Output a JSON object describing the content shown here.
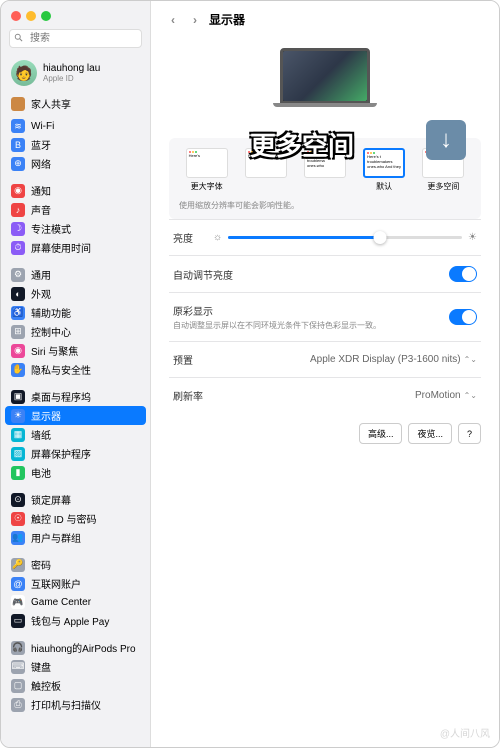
{
  "search_placeholder": "搜索",
  "user": {
    "name": "hiauhong lau",
    "sub": "Apple ID"
  },
  "family": "家人共享",
  "sidebar": [
    {
      "label": "Wi-Fi",
      "color": "#3b82f6",
      "glyph": "≋"
    },
    {
      "label": "蓝牙",
      "color": "#3b82f6",
      "glyph": "B"
    },
    {
      "label": "网络",
      "color": "#3b82f6",
      "glyph": "⊕"
    },
    {
      "sep": true
    },
    {
      "label": "通知",
      "color": "#ef4444",
      "glyph": "◉"
    },
    {
      "label": "声音",
      "color": "#ef4444",
      "glyph": "♪"
    },
    {
      "label": "专注模式",
      "color": "#8b5cf6",
      "glyph": "☽"
    },
    {
      "label": "屏幕使用时间",
      "color": "#8b5cf6",
      "glyph": "⏱"
    },
    {
      "sep": true
    },
    {
      "label": "通用",
      "color": "#9ca3af",
      "glyph": "⚙"
    },
    {
      "label": "外观",
      "color": "#111827",
      "glyph": "◐"
    },
    {
      "label": "辅助功能",
      "color": "#3b82f6",
      "glyph": "♿"
    },
    {
      "label": "控制中心",
      "color": "#9ca3af",
      "glyph": "⊞"
    },
    {
      "label": "Siri 与聚焦",
      "color": "#ec4899",
      "glyph": "◉"
    },
    {
      "label": "隐私与安全性",
      "color": "#3b82f6",
      "glyph": "✋"
    },
    {
      "sep": true
    },
    {
      "label": "桌面与程序坞",
      "color": "#111827",
      "glyph": "▣"
    },
    {
      "label": "显示器",
      "color": "#3b82f6",
      "glyph": "☀",
      "active": true
    },
    {
      "label": "墙纸",
      "color": "#06b6d4",
      "glyph": "▦"
    },
    {
      "label": "屏幕保护程序",
      "color": "#06b6d4",
      "glyph": "▨"
    },
    {
      "label": "电池",
      "color": "#22c55e",
      "glyph": "▮"
    },
    {
      "sep": true
    },
    {
      "label": "锁定屏幕",
      "color": "#111827",
      "glyph": "⊙"
    },
    {
      "label": "触控 ID 与密码",
      "color": "#ef4444",
      "glyph": "☉"
    },
    {
      "label": "用户与群组",
      "color": "#3b82f6",
      "glyph": "👥"
    },
    {
      "sep": true
    },
    {
      "label": "密码",
      "color": "#9ca3af",
      "glyph": "🔑"
    },
    {
      "label": "互联网账户",
      "color": "#3b82f6",
      "glyph": "@"
    },
    {
      "label": "Game Center",
      "color": "#fff",
      "glyph": "🎮"
    },
    {
      "label": "钱包与 Apple Pay",
      "color": "#111827",
      "glyph": "▭"
    },
    {
      "sep": true
    },
    {
      "label": "hiauhong的AirPods Pro",
      "color": "#9ca3af",
      "glyph": "🎧"
    },
    {
      "label": "键盘",
      "color": "#9ca3af",
      "glyph": "⌨"
    },
    {
      "label": "触控板",
      "color": "#9ca3af",
      "glyph": "▢"
    },
    {
      "label": "打印机与扫描仪",
      "color": "#9ca3af",
      "glyph": "⎙"
    }
  ],
  "title": "显示器",
  "overlay": "更多空间",
  "scale": {
    "opts": [
      {
        "label": "更大字体",
        "text": "Here's"
      },
      {
        "label": "",
        "text": "Here's to troublem"
      },
      {
        "label": "",
        "text": "Here's to t troublema ones.who"
      },
      {
        "label": "默认",
        "text": "Here's t troublemakers ones.who And they",
        "sel": true
      },
      {
        "label": "更多空间",
        "text": ""
      }
    ],
    "note": "使用缩放分辨率可能会影响性能。"
  },
  "rows": {
    "brightness": "亮度",
    "auto_brightness": "自动调节亮度",
    "true_tone": "原彩显示",
    "true_tone_sub": "自动调整显示屏以在不同环境光条件下保持色彩显示一致。",
    "preset": "预置",
    "preset_val": "Apple XDR Display (P3-1600 nits)",
    "refresh": "刷新率",
    "refresh_val": "ProMotion"
  },
  "buttons": {
    "advanced": "高级...",
    "night": "夜览...",
    "help": "?"
  },
  "watermark": "@人间八风"
}
